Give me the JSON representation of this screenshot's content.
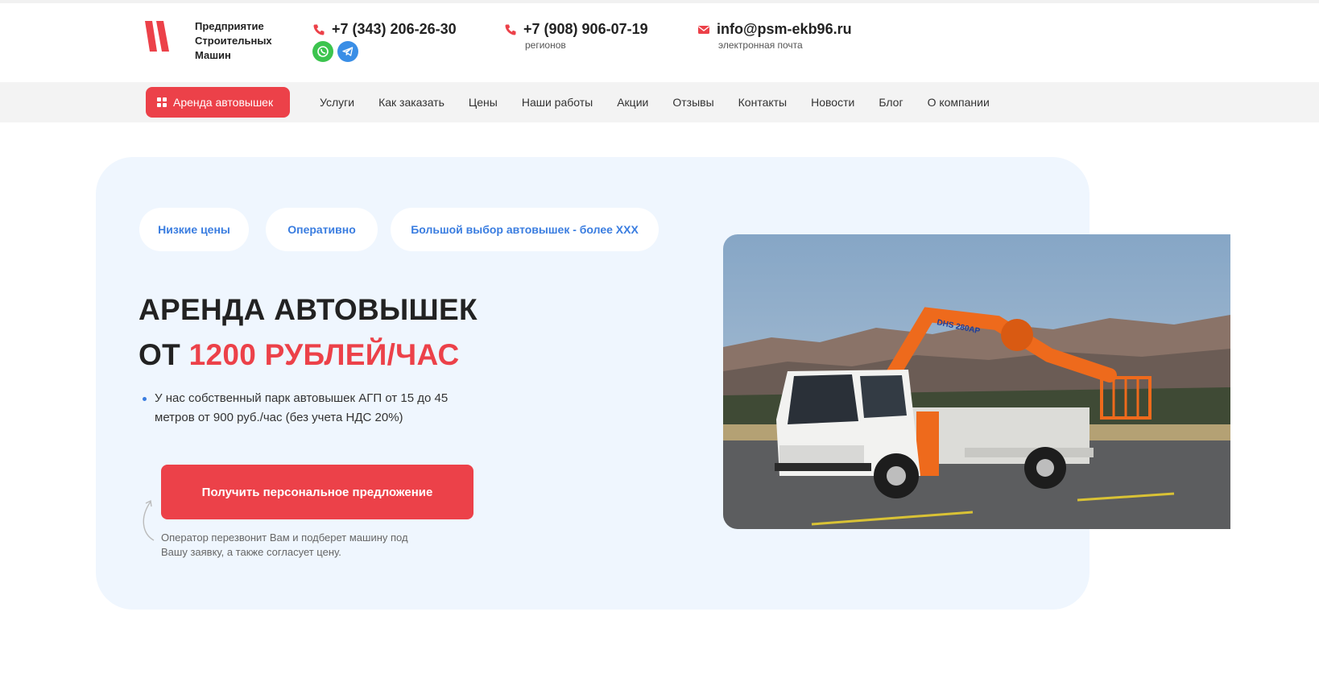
{
  "header": {
    "company_name": "Предприятие Строительных Машин",
    "phone_main": "+7 (343) 206-26-30",
    "phone_regions": "+7 (908) 906-07-19",
    "phone_regions_caption": "регионов",
    "email": "info@psm-ekb96.ru",
    "email_caption": "электронная почта",
    "messengers": [
      "whatsapp-icon",
      "telegram-icon"
    ]
  },
  "nav": {
    "main_button": "Аренда автовышек",
    "items": [
      "Услуги",
      "Как заказать",
      "Цены",
      "Наши работы",
      "Акции",
      "Отзывы",
      "Контакты",
      "Новости",
      "Блог",
      "О компании"
    ]
  },
  "hero": {
    "pills": [
      "Низкие цены",
      "Оперативно",
      "Большой выбор автовышек - более ХХХ"
    ],
    "title_line1": "АРЕНДА АВТОВЫШЕК",
    "title_line2_prefix": "ОТ",
    "title_line2_accent": "1200 РУБЛЕЙ/ЧАС",
    "bullet": "У нас собственный парк автовышек АГП от 15 до 45 метров от 900 руб./час (без учета НДС 20%)",
    "cta": "Получить персональное предложение",
    "note": "Оператор перезвонит Вам и подберет машину под Вашу заявку, а также согласует цену.",
    "image_text": "DHS 280AP"
  },
  "colors": {
    "accent": "#ec4149",
    "link_blue": "#3a7de0",
    "hero_bg": "#eff6fe",
    "nav_bg": "#f3f3f3"
  }
}
